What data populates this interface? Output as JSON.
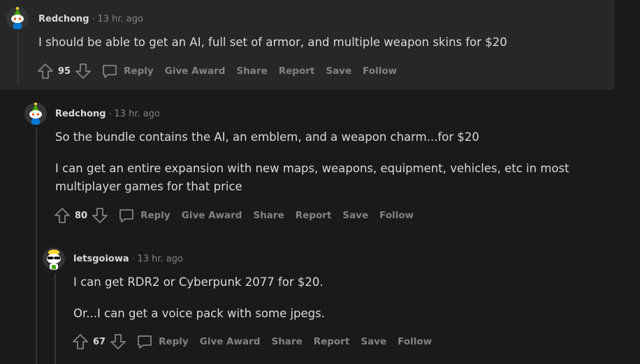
{
  "comments": [
    {
      "author": "Redchong",
      "separator": "·",
      "time": "13 hr. ago",
      "paragraphs": [
        "I should be able to get an AI, full set of armor, and multiple weapon skins for $20"
      ],
      "score": "95"
    },
    {
      "author": "Redchong",
      "separator": "·",
      "time": "13 hr. ago",
      "paragraphs": [
        "So the bundle contains the AI, an emblem, and a weapon charm...for $20",
        "I can get an entire expansion with new maps, weapons, equipment, vehicles, etc in most multiplayer games for that price"
      ],
      "score": "80"
    },
    {
      "author": "letsgoiowa",
      "separator": "·",
      "time": "13 hr. ago",
      "paragraphs": [
        "I can get RDR2 or Cyberpunk 2077 for $20.",
        "Or...I can get a voice pack with some jpegs."
      ],
      "score": "67"
    }
  ],
  "actions": {
    "reply": "Reply",
    "give_award": "Give Award",
    "share": "Share",
    "report": "Report",
    "save": "Save",
    "follow": "Follow"
  },
  "icons": {
    "upvote": "arrow-up-outline",
    "downvote": "arrow-down-outline",
    "reply": "speech-bubble-outline"
  },
  "colors": {
    "background": "#1a1a1b",
    "panel": "#272729",
    "meta_text": "#818384",
    "body_text": "#d7dadc"
  }
}
